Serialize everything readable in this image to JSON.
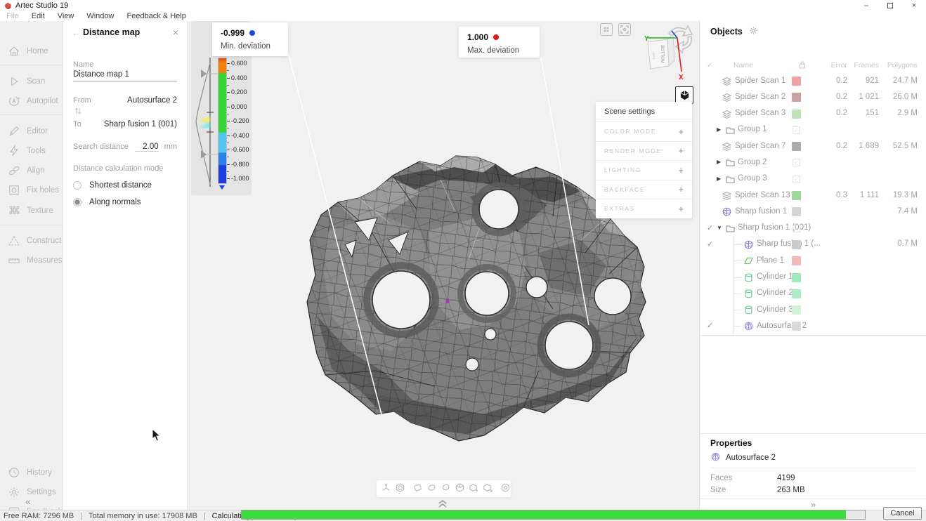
{
  "window": {
    "title": "Artec Studio 19",
    "logo_color": "#d23d33",
    "minimize_glyph": "–",
    "close_glyph": "×"
  },
  "menu": {
    "items": [
      {
        "label": "File",
        "disabled": true
      },
      {
        "label": "Edit",
        "disabled": false
      },
      {
        "label": "View",
        "disabled": false
      },
      {
        "label": "Window",
        "disabled": false
      },
      {
        "label": "Feedback & Help",
        "disabled": false
      }
    ]
  },
  "sidebar": {
    "items": [
      {
        "icon": "home-icon",
        "label": "Home"
      },
      {
        "icon": "scan-icon",
        "label": "Scan"
      },
      {
        "icon": "autopilot-icon",
        "label": "Autopilot"
      },
      {
        "icon": "editor-icon",
        "label": "Editor"
      },
      {
        "icon": "tools-icon",
        "label": "Tools"
      },
      {
        "icon": "align-icon",
        "label": "Align"
      },
      {
        "icon": "fix-holes-icon",
        "label": "Fix holes"
      },
      {
        "icon": "texture-icon",
        "label": "Texture"
      },
      {
        "icon": "construct-icon",
        "label": "Construct"
      },
      {
        "icon": "measures-icon",
        "label": "Measures"
      },
      {
        "icon": "history-icon",
        "label": "History"
      },
      {
        "icon": "settings-icon",
        "label": "Settings"
      },
      {
        "icon": "feedback-icon",
        "label": "Feedback"
      }
    ],
    "collapse_glyph": "«"
  },
  "distance_map": {
    "back_glyph": "←",
    "title": "Distance map",
    "close_glyph": "×",
    "name_label": "Name",
    "name_value": "Distance map 1",
    "from_label": "From",
    "from_value": "Autosurface 2",
    "to_label": "To",
    "to_value": "Sharp fusion 1 (001)",
    "search_label": "Search distance",
    "search_value": "2.00",
    "search_unit": "mm",
    "mode_label": "Distance calculation mode",
    "modes": [
      {
        "label": "Shortest distance",
        "selected": false
      },
      {
        "label": "Along normals",
        "selected": true
      }
    ]
  },
  "colorbar": {
    "tick_labels": [
      "0.600",
      "0.400",
      "0.200",
      "0.000",
      "-0.200",
      "-0.400",
      "-0.600",
      "-0.800",
      "-1.000"
    ],
    "gradient_colors": [
      "#dd4f10",
      "#f0830f",
      "#38d438",
      "#55c6ee",
      "#2e7fe8",
      "#1f3ddd"
    ],
    "min_card": {
      "value": "-0.999",
      "label": "Min. deviation",
      "dot_color": "#1c49d8"
    },
    "max_card": {
      "value": "1.000",
      "label": "Max. deviation",
      "dot_color": "#e11a1a"
    }
  },
  "scene_settings": {
    "title": "Scene settings",
    "sections": [
      "COLOR MODE",
      "RENDER MODE",
      "LIGHTING",
      "BACKFACE",
      "EXTRAS"
    ],
    "expand_glyph": "+"
  },
  "viewport": {
    "axis_x_label": "X",
    "axis_y_label": "Y",
    "axis_x_color": "#e01b1b",
    "axis_y_color": "#1db31d",
    "cube_face_label": "BOTTOM",
    "deviation_point_color": "#c026d3",
    "toolbar_icons": [
      "3d-axes-icon",
      "cube-orbit-icon",
      "lasso-rect-icon",
      "lasso-ellipse-icon",
      "lasso-freeform-icon",
      "cutoff-cube-icon",
      "cube-plus-icon",
      "cube-x-icon",
      "eraser-disc-icon"
    ],
    "toolbar_separators_after": [
      1,
      7
    ]
  },
  "objects": {
    "title": "Objects",
    "columns": {
      "name": "Name",
      "error": "Error",
      "frames": "Frames",
      "polygons": "Polygons"
    },
    "rows": [
      {
        "name": "Spider Scan 1",
        "icon": "scan-layers-icon",
        "indent": 0,
        "expander": "",
        "checked": false,
        "swatch": "#f0a1a1",
        "ghost": false,
        "error": "0.2",
        "frames": "921",
        "polygons": "24.7 M"
      },
      {
        "name": "Spider Scan 2",
        "icon": "scan-layers-icon",
        "indent": 0,
        "expander": "",
        "checked": false,
        "swatch": "#c9a0a4",
        "ghost": false,
        "error": "0.2",
        "frames": "1 021",
        "polygons": "26.0 M"
      },
      {
        "name": "Spider Scan 3",
        "icon": "scan-layers-icon",
        "indent": 0,
        "expander": "",
        "checked": false,
        "swatch": "#bfe3b4",
        "ghost": false,
        "error": "0.2",
        "frames": "151",
        "polygons": "2.9 M"
      },
      {
        "name": "Group 1",
        "icon": "folder-icon",
        "indent": 0,
        "expander": "collapsed",
        "checked": false,
        "swatch": "",
        "ghost": true,
        "error": "",
        "frames": "",
        "polygons": ""
      },
      {
        "name": "Spider Scan 7",
        "icon": "scan-layers-icon",
        "indent": 0,
        "expander": "",
        "checked": false,
        "swatch": "#a9adb0",
        "ghost": false,
        "error": "0.2",
        "frames": "1 689",
        "polygons": "52.5 M"
      },
      {
        "name": "Group 2",
        "icon": "folder-icon",
        "indent": 0,
        "expander": "collapsed",
        "checked": false,
        "swatch": "",
        "ghost": true,
        "error": "",
        "frames": "",
        "polygons": ""
      },
      {
        "name": "Group 3",
        "icon": "folder-icon",
        "indent": 0,
        "expander": "collapsed",
        "checked": false,
        "swatch": "",
        "ghost": true,
        "error": "",
        "frames": "",
        "polygons": ""
      },
      {
        "name": "Spider Scan 13",
        "icon": "scan-layers-icon",
        "indent": 0,
        "expander": "",
        "checked": false,
        "swatch": "#9ed89b",
        "ghost": false,
        "error": "0.3",
        "frames": "1 111",
        "polygons": "19.3 M"
      },
      {
        "name": "Sharp fusion 1",
        "icon": "fusion-sphere-icon",
        "indent": 0,
        "expander": "",
        "checked": false,
        "swatch": "#d4d6d6",
        "ghost": false,
        "error": "",
        "frames": "",
        "polygons": "7.4 M"
      },
      {
        "name": "Sharp fusion 1 (001)",
        "icon": "folder-icon",
        "indent": 0,
        "expander": "expanded",
        "checked": true,
        "swatch": "",
        "ghost": true,
        "error": "",
        "frames": "",
        "polygons": ""
      },
      {
        "name": "Sharp fusion 1 (...",
        "icon": "fusion-sphere-icon",
        "indent": 1,
        "expander": "",
        "checked": true,
        "swatch": "#c9cbcc",
        "ghost": false,
        "error": "",
        "frames": "",
        "polygons": "0.7 M"
      },
      {
        "name": "Plane 1",
        "icon": "plane-icon",
        "indent": 1,
        "expander": "",
        "checked": false,
        "swatch": "#f4b8b5",
        "ghost": false,
        "error": "",
        "frames": "",
        "polygons": ""
      },
      {
        "name": "Cylinder 1",
        "icon": "cylinder-icon",
        "indent": 1,
        "expander": "",
        "checked": false,
        "swatch": "#9fe8c0",
        "ghost": false,
        "error": "",
        "frames": "",
        "polygons": ""
      },
      {
        "name": "Cylinder 2",
        "icon": "cylinder-icon",
        "indent": 1,
        "expander": "",
        "checked": false,
        "swatch": "#aeecc8",
        "ghost": false,
        "error": "",
        "frames": "",
        "polygons": ""
      },
      {
        "name": "Cylinder 3",
        "icon": "cylinder-icon",
        "indent": 1,
        "expander": "",
        "checked": false,
        "swatch": "#d2f2da",
        "ghost": false,
        "error": "",
        "frames": "",
        "polygons": ""
      },
      {
        "name": "Autosurface 2",
        "icon": "autosurface-icon",
        "indent": 1,
        "expander": "",
        "checked": true,
        "swatch": "#d8dadb",
        "ghost": false,
        "error": "",
        "frames": "",
        "polygons": ""
      }
    ]
  },
  "properties": {
    "title": "Properties",
    "object_icon": "autosurface-icon",
    "object_name": "Autosurface 2",
    "fields": [
      {
        "label": "Faces",
        "value": "4199"
      },
      {
        "label": "Size",
        "value": "263 MB"
      }
    ],
    "expand_glyph": "»"
  },
  "statusbar": {
    "segments": [
      "Free RAM: 7296 MB",
      "Total memory in use: 17908 MB",
      "Calculating distance map"
    ],
    "separator": "|",
    "progress_percent": 97,
    "progress_color": "#3cdc3c",
    "cancel_label": "Cancel"
  }
}
